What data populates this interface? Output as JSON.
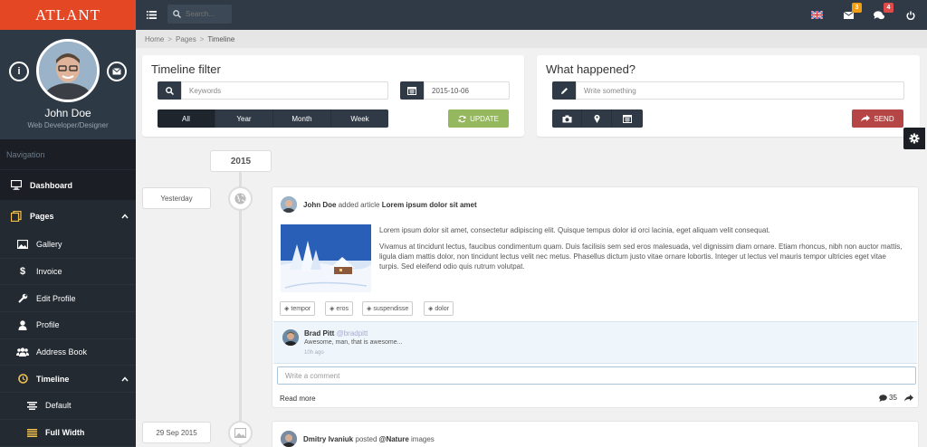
{
  "app": {
    "logo": "ATLANT"
  },
  "profile": {
    "name": "John Doe",
    "title": "Web Developer/Designer",
    "info_icon": "info-icon",
    "mail_icon": "mail-icon"
  },
  "nav": {
    "heading": "Navigation",
    "items": [
      {
        "label": "Dashboard",
        "icon": "desktop-icon"
      },
      {
        "label": "Pages",
        "icon": "files-icon"
      }
    ],
    "pages_sub": [
      {
        "label": "Gallery",
        "icon": "image-icon"
      },
      {
        "label": "Invoice",
        "icon": "dollar-icon"
      },
      {
        "label": "Edit Profile",
        "icon": "wrench-icon"
      },
      {
        "label": "Profile",
        "icon": "user-icon"
      },
      {
        "label": "Address Book",
        "icon": "users-icon"
      },
      {
        "label": "Timeline",
        "icon": "clock-icon"
      }
    ],
    "timeline_sub": [
      {
        "label": "Default",
        "icon": "align-center-icon"
      },
      {
        "label": "Full Width",
        "icon": "align-justify-icon"
      }
    ]
  },
  "topbar": {
    "search_placeholder": "Search...",
    "mail_badge": "3",
    "chat_badge": "4",
    "colors": {
      "mail_badge": "#f39c12",
      "chat_badge": "#e04b4a"
    }
  },
  "breadcrumb": [
    "Home",
    "Pages",
    "Timeline"
  ],
  "filter": {
    "title": "Timeline filter",
    "keywords_placeholder": "Keywords",
    "date_value": "2015-10-06",
    "segments": [
      "All",
      "Year",
      "Month",
      "Week"
    ],
    "active_segment": "All",
    "update_label": "UPDATE"
  },
  "happened": {
    "title": "What happened?",
    "placeholder": "Write something",
    "send_label": "SEND"
  },
  "timeline": {
    "year": "2015",
    "entries": [
      {
        "date": "Yesterday",
        "author": "John Doe",
        "action": "added article",
        "target": "Lorem ipsum dolor sit amet",
        "para1": "Lorem ipsum dolor sit amet, consectetur adipiscing elit. Quisque tempus dolor id orci lacinia, eget aliquam velit consequat.",
        "para2": "Vivamus at tincidunt lectus, faucibus condimentum quam. Duis facilisis sem sed eros malesuada, vel dignissim diam ornare. Etiam rhoncus, nibh non auctor mattis, ligula diam mattis dolor, non tincidunt lectus velit nec metus. Phasellus dictum justo vitae ornare lobortis. Integer ut lectus vel mauris tempor ultricies eget vitae turpis. Sed eleifend odio quis rutrum volutpat.",
        "tags": [
          "tempor",
          "eros",
          "suspendisse",
          "dolor"
        ],
        "comment": {
          "author": "Brad Pitt",
          "handle": "@bradpitt",
          "text": "Awesome, man, that is awesome...",
          "time": "10h ago"
        },
        "comment_placeholder": "Write a comment",
        "read_more": "Read more",
        "comment_count": "35"
      },
      {
        "date": "29 Sep 2015",
        "author": "Dmitry Ivaniuk",
        "action": "posted",
        "target": "@Nature",
        "suffix": "images"
      }
    ]
  }
}
